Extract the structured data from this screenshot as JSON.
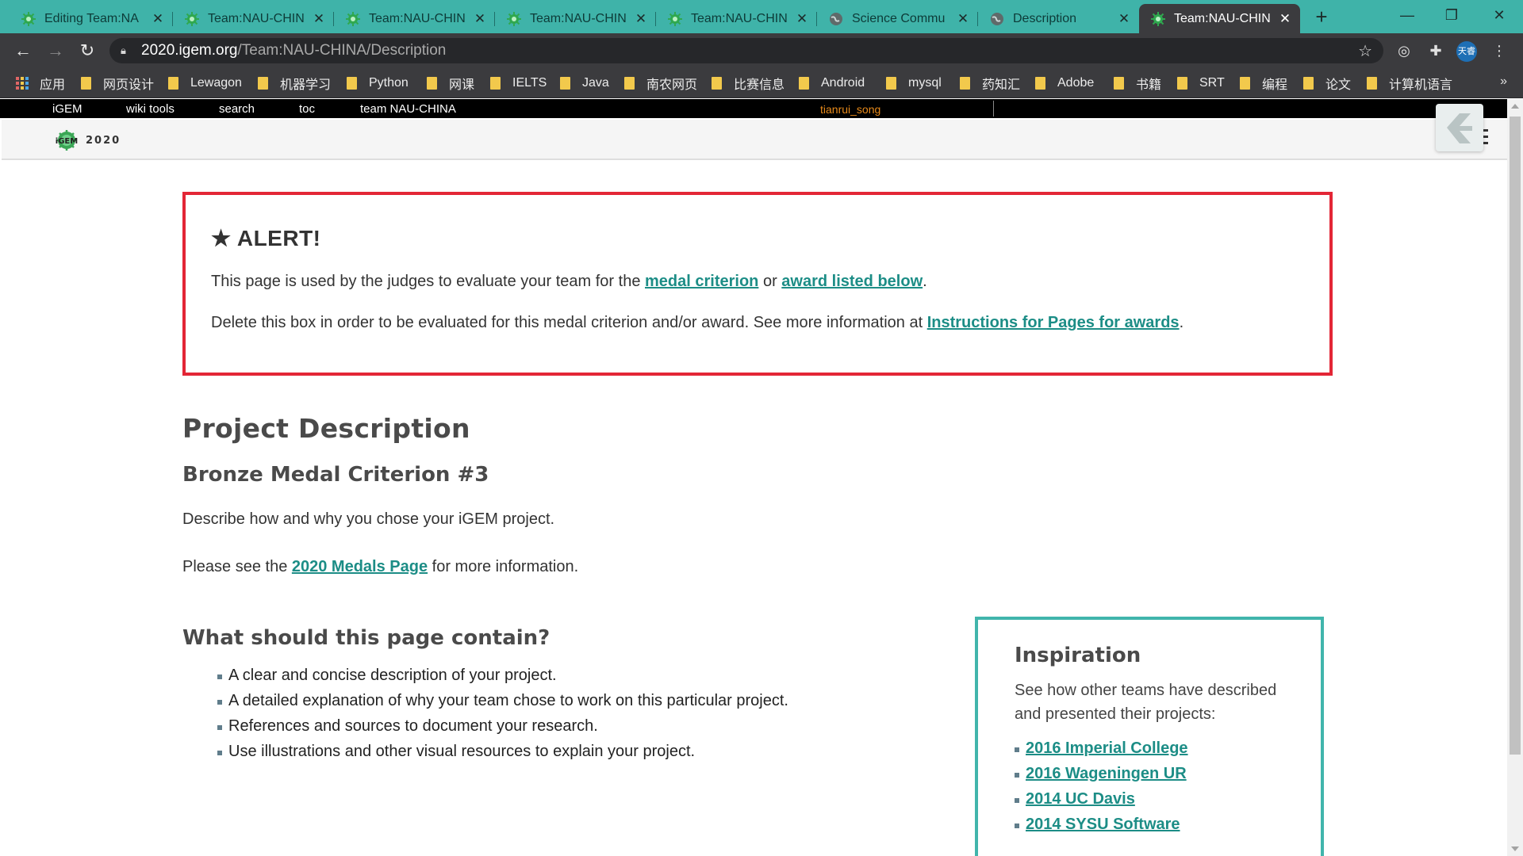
{
  "tabs": [
    {
      "title": "Editing Team:NA",
      "active": false
    },
    {
      "title": "Team:NAU-CHIN",
      "active": false
    },
    {
      "title": "Team:NAU-CHIN",
      "active": false
    },
    {
      "title": "Team:NAU-CHIN",
      "active": false
    },
    {
      "title": "Team:NAU-CHIN",
      "active": false
    },
    {
      "title": "Science Commu",
      "active": false
    },
    {
      "title": "Description",
      "active": false
    },
    {
      "title": "Team:NAU-CHIN",
      "active": true
    }
  ],
  "address": {
    "host": "2020.igem.org",
    "path": "/Team:NAU-CHINA/Description"
  },
  "profile_badge": "天睿",
  "bookmarks": [
    "应用",
    "网页设计",
    "Lewagon",
    "机器学习",
    "Python",
    "网课",
    "IELTS",
    "Java",
    "南农网页",
    "比赛信息",
    "Android",
    "mysql",
    "药知汇",
    "Adobe",
    "书籍",
    "SRT",
    "编程",
    "论文",
    "计算机语言"
  ],
  "igem_bar": {
    "links": [
      "iGEM",
      "wiki tools",
      "search",
      "toc",
      "team NAU-CHINA"
    ],
    "user": "tianrui_song"
  },
  "site_header": {
    "logo_year": "2020"
  },
  "alert": {
    "title": "★ ALERT!",
    "line1_prefix": "This page is used by the judges to evaluate your team for the ",
    "line1_link1": "medal criterion",
    "line1_mid": " or ",
    "line1_link2": "award listed below",
    "line1_suffix": ".",
    "line2_prefix": "Delete this box in order to be evaluated for this medal criterion and/or award. See more information at ",
    "line2_link": "Instructions for Pages for awards",
    "line2_suffix": "."
  },
  "main": {
    "title": "Project Description",
    "subtitle": "Bronze Medal Criterion #3",
    "describe": "Describe how and why you chose your iGEM project.",
    "see_prefix": "Please see the ",
    "see_link": "2020 Medals Page",
    "see_suffix": " for more information.",
    "what_title": "What should this page contain?",
    "what_items": [
      "A clear and concise description of your project.",
      "A detailed explanation of why your team chose to work on this particular project.",
      "References and sources to document your research.",
      "Use illustrations and other visual resources to explain your project."
    ]
  },
  "inspiration": {
    "title": "Inspiration",
    "text": "See how other teams have described and presented their projects:",
    "links": [
      "2016 Imperial College",
      "2016 Wageningen UR",
      "2014 UC Davis",
      "2014 SYSU Software"
    ]
  },
  "colors": {
    "tab_bar": "#3fb3a9",
    "chrome_dark": "#3b3b3e",
    "alert_border": "#e32636",
    "link": "#1c8d86",
    "inspiration_border": "#41b5ac",
    "igem_user": "#e88a1a"
  }
}
